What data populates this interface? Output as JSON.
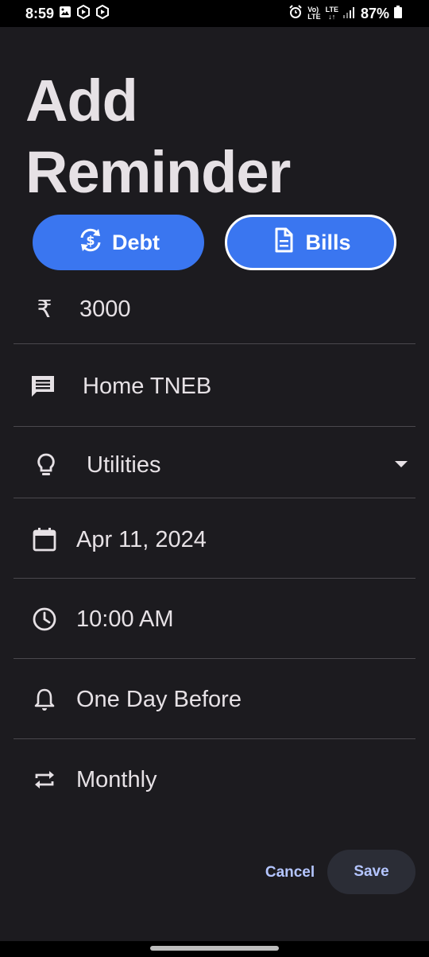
{
  "status_bar": {
    "time": "8:59",
    "network_top": "Vo)",
    "network_bottom": "LTE",
    "lte_label": "LTE",
    "battery": "87%"
  },
  "page": {
    "title_line1": "Add",
    "title_line2": "Reminder"
  },
  "type_selector": {
    "debt_label": "Debt",
    "bills_label": "Bills",
    "selected": "Bills"
  },
  "form": {
    "amount": "3000",
    "currency_symbol": "₹",
    "description": "Home TNEB",
    "category": "Utilities",
    "date": "Apr 11, 2024",
    "time": "10:00 AM",
    "reminder": "One Day Before",
    "repeat": "Monthly"
  },
  "actions": {
    "cancel_label": "Cancel",
    "save_label": "Save"
  },
  "colors": {
    "background": "#1c1b1f",
    "accent_chip": "#3a76f0",
    "action_text": "#b4c5ff",
    "divider": "#4a484d"
  }
}
